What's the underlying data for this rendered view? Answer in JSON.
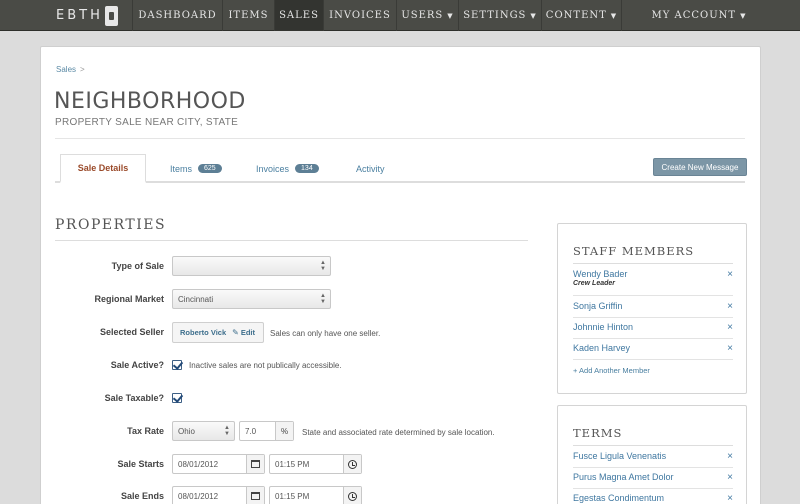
{
  "nav": {
    "logo": "EBTH",
    "items": [
      {
        "label": "DASHBOARD"
      },
      {
        "label": "ITEMS"
      },
      {
        "label": "SALES"
      },
      {
        "label": "INVOICES"
      },
      {
        "label": "USERS"
      },
      {
        "label": "SETTINGS"
      },
      {
        "label": "CONTENT"
      },
      {
        "label": "MY ACCOUNT"
      }
    ],
    "active": "SALES"
  },
  "breadcrumb": {
    "item": "Sales",
    "separator": ">"
  },
  "page": {
    "title": "NEIGHBORHOOD",
    "subtitle": "PROPERTY SALE NEAR CITY, STATE"
  },
  "tabs": [
    {
      "label": "Sale Details",
      "count": ""
    },
    {
      "label": "Items",
      "count": "625"
    },
    {
      "label": "Invoices",
      "count": "134"
    },
    {
      "label": "Activity",
      "count": ""
    }
  ],
  "create_message_label": "Create New Message",
  "properties": {
    "heading": "PROPERTIES",
    "type_of_sale": {
      "label": "Type of Sale",
      "value": ""
    },
    "regional_market": {
      "label": "Regional Market",
      "value": "Cincinnati"
    },
    "selected_seller": {
      "label": "Selected Seller",
      "seller": "Roberto Vick",
      "edit": "Edit",
      "help": "Sales can only have one seller."
    },
    "sale_active": {
      "label": "Sale Active?",
      "help": "Inactive sales are not publically accessible.",
      "checked": true
    },
    "sale_taxable": {
      "label": "Sale Taxable?",
      "checked": true
    },
    "tax_rate": {
      "label": "Tax Rate",
      "state": "Ohio",
      "rate": "7.0",
      "unit": "%",
      "help": "State and associated rate determined by sale location."
    },
    "sale_starts": {
      "label": "Sale Starts",
      "date": "08/01/2012",
      "time": "01:15 PM"
    },
    "sale_ends": {
      "label": "Sale Ends",
      "date": "08/01/2012",
      "time": "01:15 PM"
    }
  },
  "staff": {
    "heading": "STAFF MEMBERS",
    "members": [
      {
        "name": "Wendy Bader",
        "role": "Crew Leader"
      },
      {
        "name": "Sonja Griffin",
        "role": ""
      },
      {
        "name": "Johnnie Hinton",
        "role": ""
      },
      {
        "name": "Kaden Harvey",
        "role": ""
      }
    ],
    "add_label": "+ Add Another Member"
  },
  "terms": {
    "heading": "TERMS",
    "items": [
      {
        "name": "Fusce Ligula Venenatis"
      },
      {
        "name": "Purus Magna Amet Dolor"
      },
      {
        "name": "Egestas Condimentum"
      }
    ]
  },
  "remove_icon": "×",
  "colors": {
    "nav_bg": "#4a4b46",
    "link": "#3f77a0",
    "accent_tab": "#9a4a2a",
    "button": "#7c96a6"
  }
}
